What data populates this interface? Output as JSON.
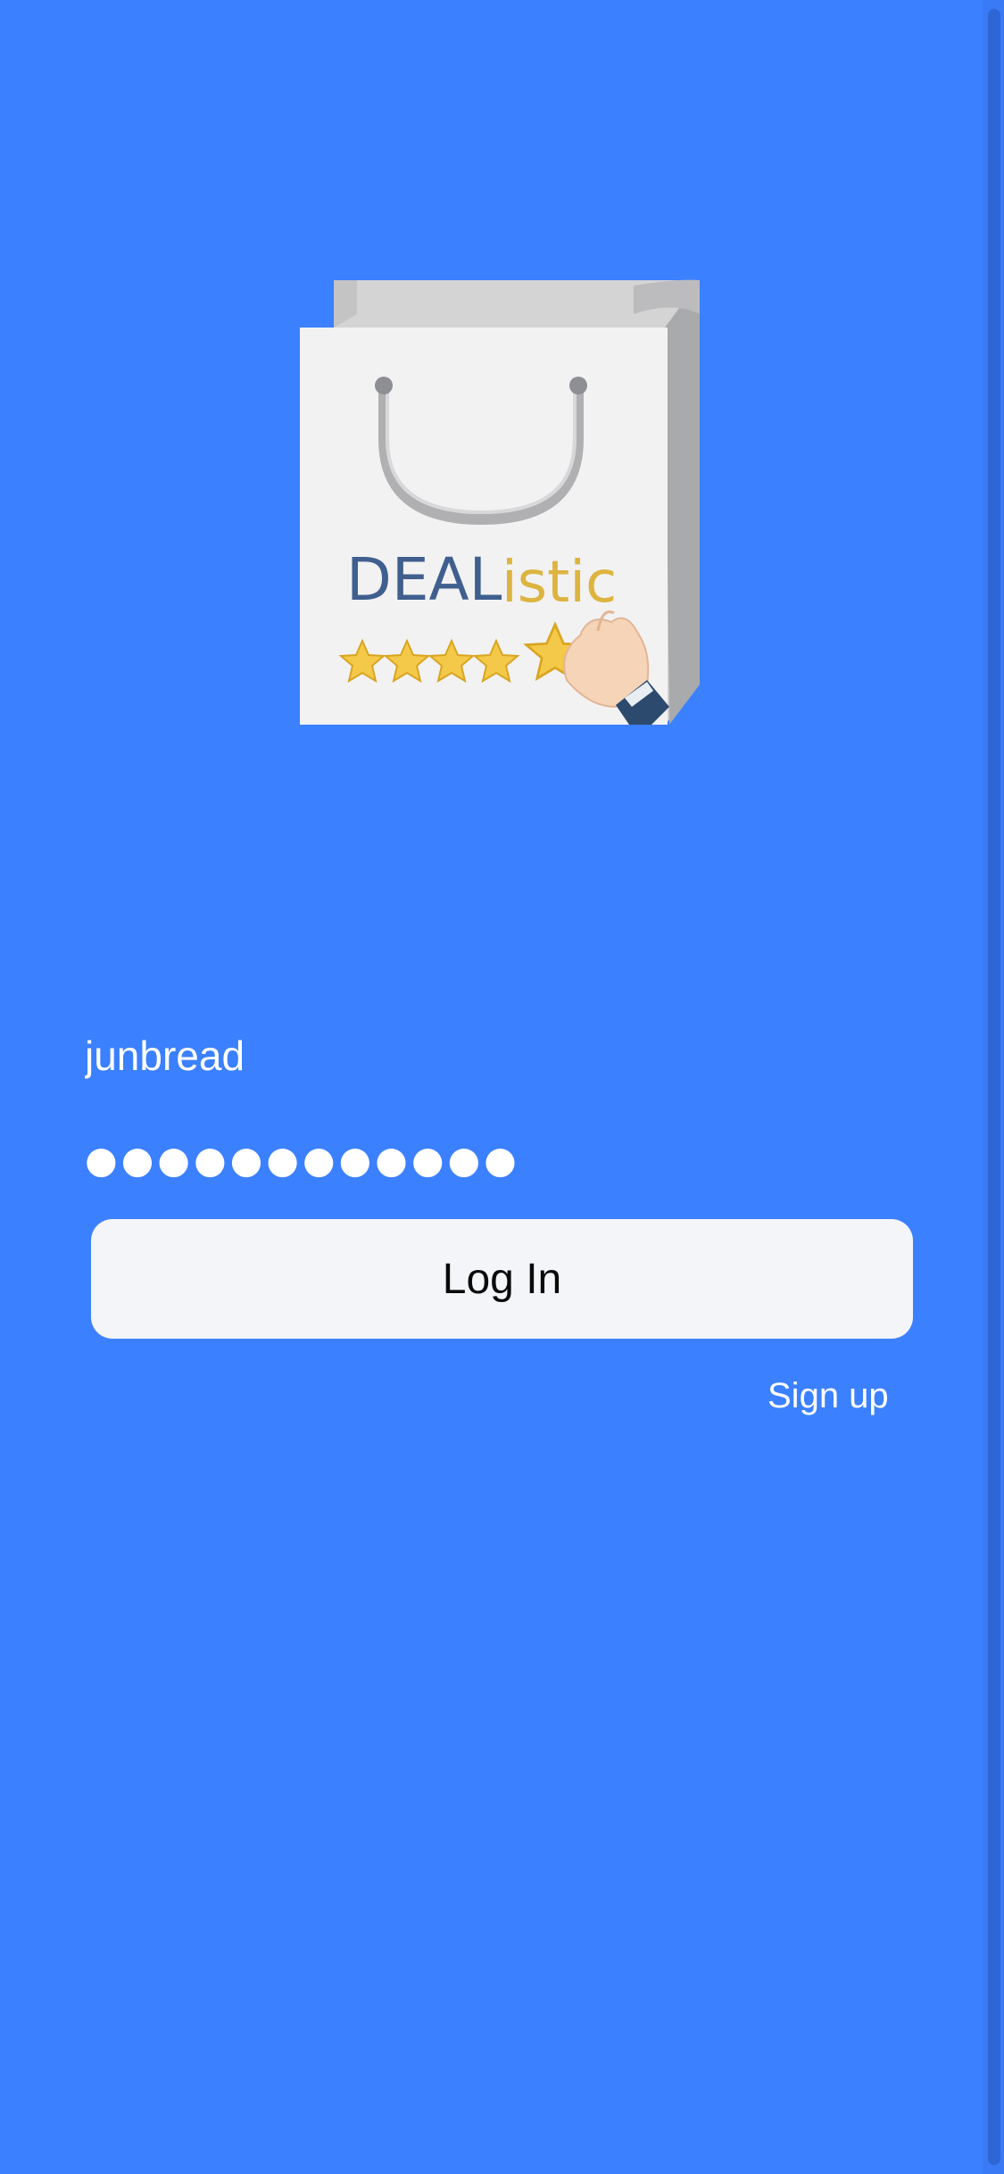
{
  "app": {
    "brand": "DEAListic",
    "logo_parts": [
      "DEAL",
      "istic"
    ],
    "logo_rating_stars": 4.5,
    "colors": {
      "background": "#3b80ff",
      "button_bg": "#f4f5f8",
      "brand_blue": "#3f5f8e",
      "brand_gold": "#dcb43f",
      "star": "#f4c94a"
    }
  },
  "login": {
    "username_value": "junbread",
    "password_mask": "●●●●●●●●●●●●",
    "login_label": "Log In",
    "signup_label": "Sign up"
  }
}
